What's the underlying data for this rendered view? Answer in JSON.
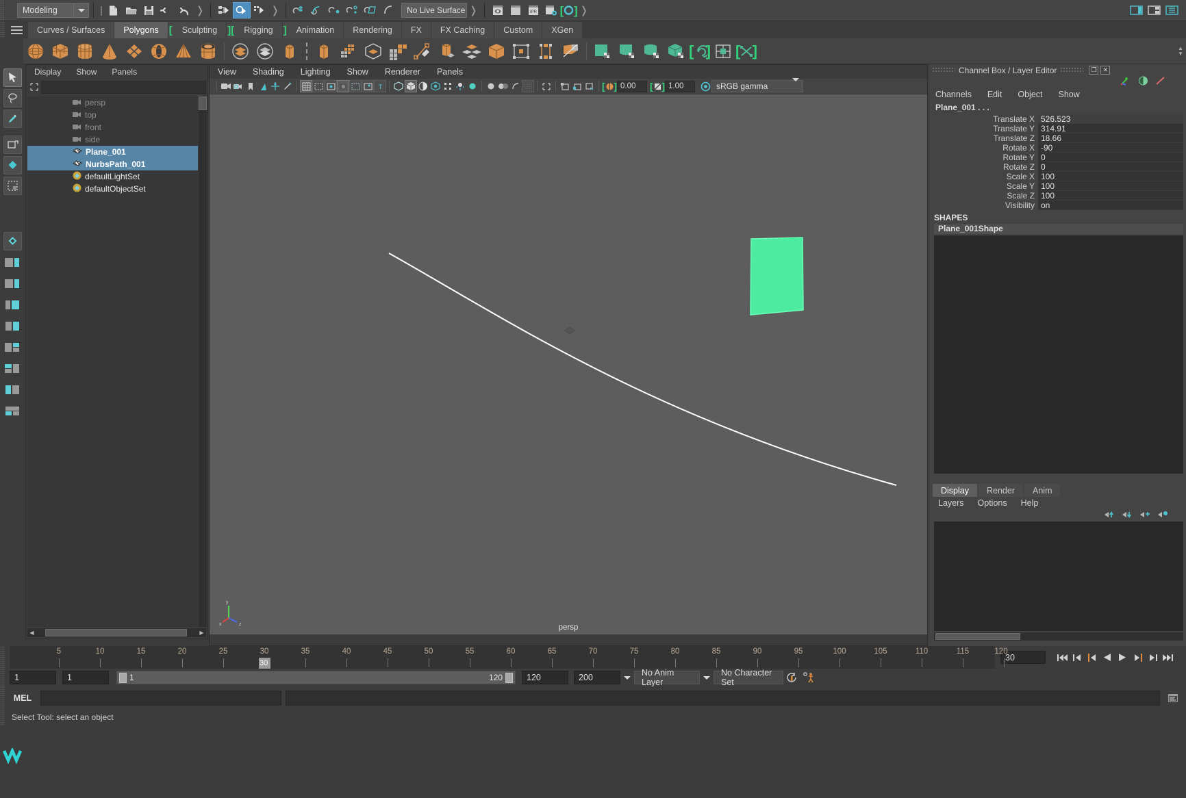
{
  "statusline": {
    "menu_set": "Modeling",
    "live_surface": "No Live Surface",
    "icons": [
      "new-scene-icon",
      "open-scene-icon",
      "save-scene-icon",
      "undo-icon",
      "redo-icon",
      "select-by-hierarchy-icon",
      "select-by-object-icon",
      "select-by-component-icon",
      "snap-to-grid-icon",
      "snap-to-curve-icon",
      "snap-to-point-icon",
      "snap-to-projected-center-icon",
      "snap-to-view-plane-icon",
      "make-live-icon",
      "render-view-icon",
      "render-current-frame-icon",
      "ipr-render-icon",
      "render-settings-icon",
      "hypershade-icon"
    ],
    "right_icons": [
      "toggle-sidebar-icon",
      "toggle-attribute-editor-icon",
      "toggle-channel-box-icon"
    ]
  },
  "shelf_tabs": [
    {
      "label": "Curves / Surfaces",
      "active": false
    },
    {
      "label": "Polygons",
      "active": true
    },
    {
      "label": "Sculpting",
      "active": false
    },
    {
      "label": "Rigging",
      "active": false
    },
    {
      "label": "Animation",
      "active": false
    },
    {
      "label": "Rendering",
      "active": false
    },
    {
      "label": "FX",
      "active": false
    },
    {
      "label": "FX Caching",
      "active": false
    },
    {
      "label": "Custom",
      "active": false
    },
    {
      "label": "XGen",
      "active": false
    }
  ],
  "shelf_items": [
    "poly-sphere-icon",
    "poly-cube-icon",
    "poly-cylinder-icon",
    "poly-cone-icon",
    "poly-plane-icon",
    "poly-torus-icon",
    "poly-pyramid-icon",
    "poly-pipe-icon",
    "combine-icon",
    "separate-icon",
    "extrude-icon",
    "booleans-icon",
    "poly-smooth-icon",
    "smooth-proxy-icon",
    "mirror-geometry-icon",
    "multi-cut-icon",
    "bevel-icon",
    "bridge-icon",
    "append-polygon-icon",
    "wedge-face-icon",
    "target-weld-icon",
    "quad-draw-icon",
    "crease-tool-icon",
    "uv-editor-icon",
    "planar-mapping-icon",
    "cylindrical-mapping-icon",
    "spherical-mapping-icon",
    "automatic-mapping-icon",
    "uv-snapshot-icon",
    "uv-grid-icon",
    "uv-layout-icon"
  ],
  "toolbox": [
    "select-tool-icon",
    "lasso-select-tool-icon",
    "paint-select-tool-icon",
    "move-tool-icon",
    "rotate-tool-icon",
    "scale-tool-icon",
    "last-tool-icon",
    "persp-layout-icon",
    "two-pane-layout-icon",
    "three-pane-layout-icon",
    "four-pane-layout-icon",
    "outliner-layout-icon",
    "hypergraph-layout-icon",
    "hypershade-layout-icon",
    "graph-editor-layout-icon",
    "maya-logo-icon"
  ],
  "outliner": {
    "menus": [
      "Display",
      "Show",
      "Panels"
    ],
    "search_value": "",
    "search_placeholder": "",
    "filter_icon": "filter-icon",
    "items": [
      {
        "label": "persp",
        "icon": "camera-icon",
        "state": "dim",
        "selected": false
      },
      {
        "label": "top",
        "icon": "camera-icon",
        "state": "dim",
        "selected": false
      },
      {
        "label": "front",
        "icon": "camera-icon",
        "state": "dim",
        "selected": false
      },
      {
        "label": "side",
        "icon": "camera-icon",
        "state": "dim",
        "selected": false
      },
      {
        "label": "Plane_001",
        "icon": "mesh-icon",
        "state": "bold",
        "selected": true
      },
      {
        "label": "NurbsPath_001",
        "icon": "mesh-icon",
        "state": "bold",
        "selected": true
      },
      {
        "label": "defaultLightSet",
        "icon": "set-icon",
        "state": "bold",
        "selected": false
      },
      {
        "label": "defaultObjectSet",
        "icon": "set-icon",
        "state": "bold",
        "selected": false
      }
    ]
  },
  "viewport": {
    "menus": [
      "View",
      "Shading",
      "Lighting",
      "Show",
      "Renderer",
      "Panels"
    ],
    "exposure_value": "0.00",
    "gamma_value": "1.00",
    "color_management": "sRGB gamma",
    "camera_label": "persp",
    "axis_labels": [
      "x",
      "y",
      "z"
    ],
    "toolbar_icons": [
      "select-camera-icon",
      "camera-attributes-icon",
      "bookmark-icon",
      "image-plane-icon",
      "two-d-pan-zoom-icon",
      "oil-paint-icon",
      "grid-toggle-icon",
      "film-gate-icon",
      "resolution-gate-icon",
      "gate-mask-icon",
      "film-origin-icon",
      "safe-action-icon",
      "field-chart-icon",
      "wireframe-icon",
      "smooth-shade-icon",
      "shade-wireframe-icon",
      "texture-icon",
      "use-all-lights-icon",
      "shadows-icon",
      "screen-space-ao-icon",
      "motion-blur-icon",
      "isolate-select-icon",
      "xray-icon",
      "xray-joints-icon",
      "xray-active-components-icon",
      "exposure-icon",
      "gamma-icon",
      "color-management-icon"
    ]
  },
  "channelbox": {
    "title": "Channel Box / Layer Editor",
    "dock_icon": "undock-icon",
    "close_icon": "close-icon",
    "header_icons": [
      "channel-box-icon",
      "attribute-editor-icon",
      "modeling-toolkit-icon"
    ],
    "menus": [
      "Channels",
      "Edit",
      "Object",
      "Show"
    ],
    "object_name": "Plane_001 . . .",
    "attributes": [
      {
        "label": "Translate X",
        "value": "526.523"
      },
      {
        "label": "Translate Y",
        "value": "314.91"
      },
      {
        "label": "Translate Z",
        "value": "18.66"
      },
      {
        "label": "Rotate X",
        "value": "-90"
      },
      {
        "label": "Rotate Y",
        "value": "0"
      },
      {
        "label": "Rotate Z",
        "value": "0"
      },
      {
        "label": "Scale X",
        "value": "100"
      },
      {
        "label": "Scale Y",
        "value": "100"
      },
      {
        "label": "Scale Z",
        "value": "100"
      },
      {
        "label": "Visibility",
        "value": "on"
      }
    ],
    "shapes_header": "SHAPES",
    "shape_name": "Plane_001Shape"
  },
  "layereditor": {
    "tabs": [
      {
        "label": "Display",
        "active": true
      },
      {
        "label": "Render",
        "active": false
      },
      {
        "label": "Anim",
        "active": false
      }
    ],
    "menus": [
      "Layers",
      "Options",
      "Help"
    ],
    "icons": [
      "move-layer-up-icon",
      "move-layer-down-icon",
      "new-layer-from-selected-icon",
      "new-layer-icon"
    ]
  },
  "timeslider": {
    "ticks": [
      {
        "label": "5",
        "frame": 5
      },
      {
        "label": "10",
        "frame": 10
      },
      {
        "label": "15",
        "frame": 15
      },
      {
        "label": "20",
        "frame": 20
      },
      {
        "label": "25",
        "frame": 25
      },
      {
        "label": "30",
        "frame": 30
      },
      {
        "label": "35",
        "frame": 35
      },
      {
        "label": "40",
        "frame": 40
      },
      {
        "label": "45",
        "frame": 45
      },
      {
        "label": "50",
        "frame": 50
      },
      {
        "label": "55",
        "frame": 55
      },
      {
        "label": "60",
        "frame": 60
      },
      {
        "label": "65",
        "frame": 65
      },
      {
        "label": "70",
        "frame": 70
      },
      {
        "label": "75",
        "frame": 75
      },
      {
        "label": "80",
        "frame": 80
      },
      {
        "label": "85",
        "frame": 85
      },
      {
        "label": "90",
        "frame": 90
      },
      {
        "label": "95",
        "frame": 95
      },
      {
        "label": "100",
        "frame": 100
      },
      {
        "label": "105",
        "frame": 105
      },
      {
        "label": "110",
        "frame": 110
      },
      {
        "label": "115",
        "frame": 115
      },
      {
        "label": "120",
        "frame": 120
      }
    ],
    "current_frame": "30",
    "current_frame_field": "30",
    "range_start": 1,
    "range_end": 120,
    "playback_buttons": [
      "go-to-start-icon",
      "step-back-keyframe-icon",
      "step-back-frame-icon",
      "play-backwards-icon",
      "play-forwards-icon",
      "step-forward-frame-icon",
      "step-forward-keyframe-icon",
      "go-to-end-icon"
    ]
  },
  "rangeslider": {
    "anim_start": "1",
    "range_start": "1",
    "bar_start_label": "1",
    "bar_end_label": "120",
    "range_end": "120",
    "anim_end": "200",
    "anim_layer": "No Anim Layer",
    "character_set": "No Character Set",
    "auto_key_icon": "auto-keyframe-icon",
    "anim_prefs_icon": "animation-preferences-icon"
  },
  "commandline": {
    "label": "MEL",
    "input_value": "",
    "output_value": ""
  },
  "helpline": {
    "text": "Select Tool: select an object"
  },
  "colors": {
    "accent_green": "#33d17a",
    "plane_green": "#4ceba0",
    "selection_blue": "#5785a6",
    "orange": "#e08a3c",
    "panel_bg": "#3c3c3c",
    "viewport_bg": "#5d5d5d"
  }
}
